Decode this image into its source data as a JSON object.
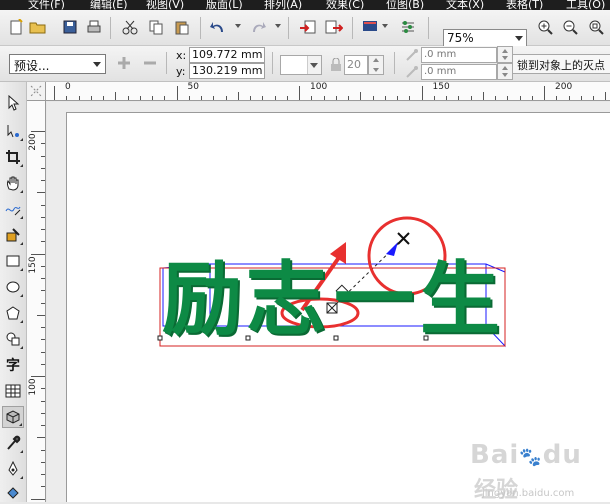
{
  "menu": {
    "items": [
      "文件(F)",
      "编辑(E)",
      "视图(V)",
      "版面(L)",
      "排列(A)",
      "效果(C)",
      "位图(B)",
      "文本(X)",
      "表格(T)",
      "工具(O)"
    ]
  },
  "toolbar": {
    "zoom_value": "75%"
  },
  "property_bar": {
    "preset_value": "预设...",
    "x_label": "x:",
    "x_value": "109.772 mm",
    "y_label": "y:",
    "y_value": "130.219 mm",
    "depth_value": "20",
    "vanish_x_value": ".0 mm",
    "vanish_y_value": ".0 mm",
    "snap_label": "锁到对象上的灭点"
  },
  "ruler": {
    "h_labels": [
      "0",
      "50",
      "100",
      "150",
      "200"
    ],
    "v_labels": [
      "200",
      "150",
      "100"
    ]
  },
  "artwork": {
    "text": "励志一生",
    "color": "#0d8a45"
  },
  "watermark": {
    "logo": "Bai",
    "logo_tail": "du",
    "text": "经验",
    "url": "jingyan.baidu.com"
  },
  "colors": {
    "annotation_red": "#e8302f",
    "extrude_blue": "#1a1aff",
    "bbox_red": "#d42020"
  }
}
